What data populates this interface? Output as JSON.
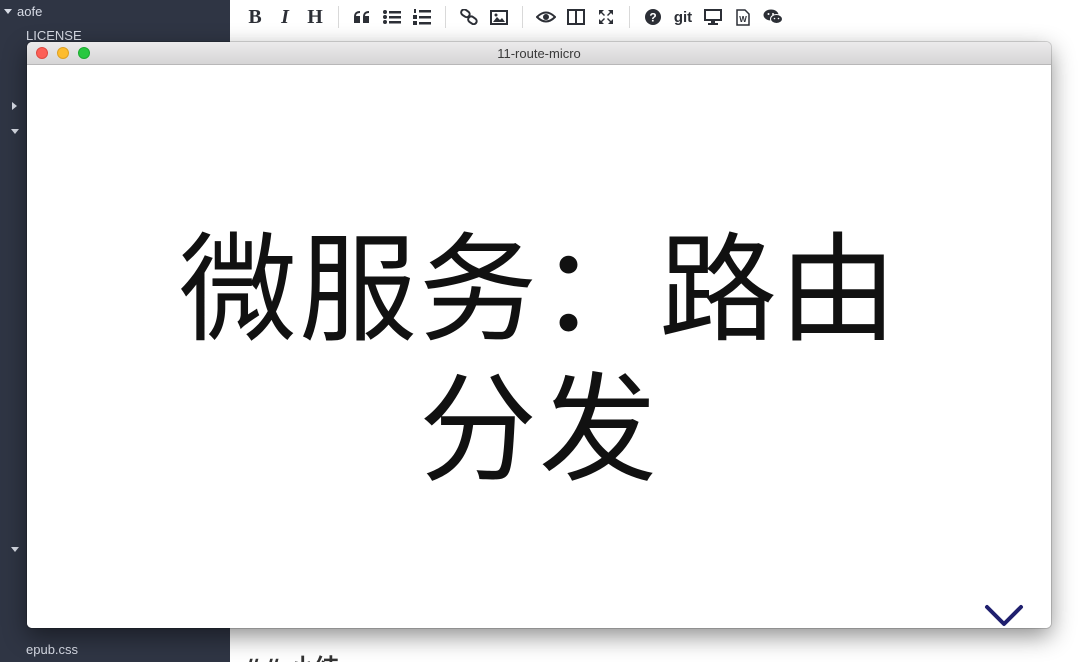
{
  "sidebar": {
    "root_folder": "aofe",
    "items": [
      {
        "label": "LICENSE"
      },
      {
        "label": "epub.css"
      }
    ]
  },
  "toolbar": {
    "buttons": [
      {
        "name": "bold",
        "glyph": "B"
      },
      {
        "name": "italic",
        "glyph": "I"
      },
      {
        "name": "heading",
        "glyph": "H"
      },
      {
        "name": "git",
        "glyph": "git"
      }
    ]
  },
  "editor": {
    "bottom_text": "## 小结"
  },
  "preview_window": {
    "title": "11-route-micro",
    "slide_title": "微服务：路由分发",
    "accent_color": "#1f1f6e"
  }
}
